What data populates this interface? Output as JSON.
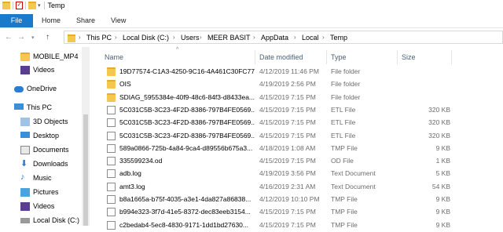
{
  "window": {
    "title": "Temp"
  },
  "ribbon": {
    "tabs": [
      "File",
      "Home",
      "Share",
      "View"
    ]
  },
  "address": {
    "crumbs": [
      "This PC",
      "Local Disk (C:)",
      "Users",
      "MEER BASIT",
      "AppData",
      "Local",
      "Temp"
    ]
  },
  "nav_pane": {
    "items": [
      {
        "label": "MOBILE_MP4",
        "icon": "folder-icon"
      },
      {
        "label": "Videos",
        "icon": "videos-icon"
      },
      {
        "label": "OneDrive",
        "icon": "cloud-icon"
      },
      {
        "label": "This PC",
        "icon": "computer-icon"
      },
      {
        "label": "3D Objects",
        "icon": "cube-icon"
      },
      {
        "label": "Desktop",
        "icon": "desktop-icon"
      },
      {
        "label": "Documents",
        "icon": "documents-icon"
      },
      {
        "label": "Downloads",
        "icon": "download-icon"
      },
      {
        "label": "Music",
        "icon": "music-icon"
      },
      {
        "label": "Pictures",
        "icon": "pictures-icon"
      },
      {
        "label": "Videos",
        "icon": "videos-icon"
      },
      {
        "label": "Local Disk (C:)",
        "icon": "drive-icon"
      }
    ]
  },
  "columns": {
    "name": "Name",
    "date": "Date modified",
    "type": "Type",
    "size": "Size"
  },
  "files": [
    {
      "name": "19D77574-C1A3-4250-9C16-4A461C30FC77",
      "date": "4/12/2019 11:46 PM",
      "type": "File folder",
      "size": "",
      "kind": "folder"
    },
    {
      "name": "OIS",
      "date": "4/19/2019 2:56 PM",
      "type": "File folder",
      "size": "",
      "kind": "folder"
    },
    {
      "name": "SDIAG_5955384e-40f9-48c6-84f3-d8433ea...",
      "date": "4/15/2019 7:15 PM",
      "type": "File folder",
      "size": "",
      "kind": "folder"
    },
    {
      "name": "5C031C5B-3C23-4F2D-8386-797B4FE0569...",
      "date": "4/15/2019 7:15 PM",
      "type": "ETL File",
      "size": "320 KB",
      "kind": "doc"
    },
    {
      "name": "5C031C5B-3C23-4F2D-8386-797B4FE0569...",
      "date": "4/15/2019 7:15 PM",
      "type": "ETL File",
      "size": "320 KB",
      "kind": "doc"
    },
    {
      "name": "5C031C5B-3C23-4F2D-8386-797B4FE0569...",
      "date": "4/15/2019 7:15 PM",
      "type": "ETL File",
      "size": "320 KB",
      "kind": "doc"
    },
    {
      "name": "589a0866-725b-4a84-9ca4-d89556b675a3...",
      "date": "4/18/2019 1:08 AM",
      "type": "TMP File",
      "size": "9 KB",
      "kind": "doc"
    },
    {
      "name": "335599234.od",
      "date": "4/15/2019 7:15 PM",
      "type": "OD File",
      "size": "1 KB",
      "kind": "doc"
    },
    {
      "name": "adb.log",
      "date": "4/19/2019 3:56 PM",
      "type": "Text Document",
      "size": "5 KB",
      "kind": "doc"
    },
    {
      "name": "amt3.log",
      "date": "4/16/2019 2:31 AM",
      "type": "Text Document",
      "size": "54 KB",
      "kind": "doc"
    },
    {
      "name": "b8a1665a-b75f-4035-a3e1-4da827a86838...",
      "date": "4/12/2019 10:10 PM",
      "type": "TMP File",
      "size": "9 KB",
      "kind": "doc"
    },
    {
      "name": "b994e323-3f7d-41e5-8372-dec83eeb3154...",
      "date": "4/15/2019 7:15 PM",
      "type": "TMP File",
      "size": "9 KB",
      "kind": "doc"
    },
    {
      "name": "c2bedab4-5ec8-4830-9171-1dd1bd27630...",
      "date": "4/15/2019 7:15 PM",
      "type": "TMP File",
      "size": "9 KB",
      "kind": "doc"
    }
  ],
  "colors": {
    "accent": "#1979ca",
    "folder": "#f4c74f",
    "header_text": "#4c607a"
  }
}
